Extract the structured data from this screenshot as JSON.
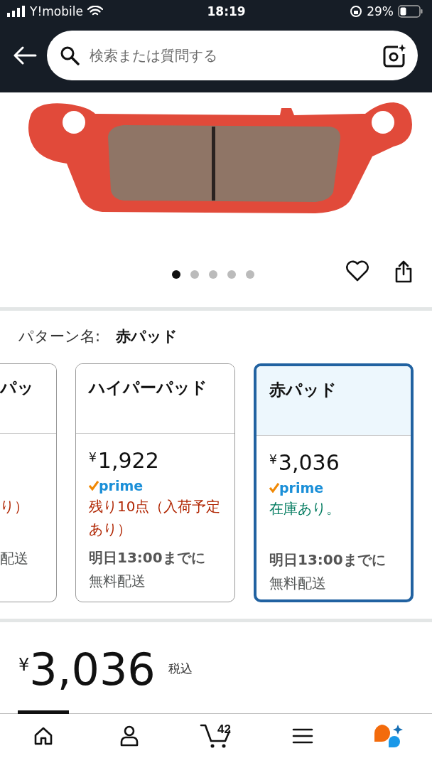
{
  "status_bar": {
    "carrier": "Y!mobile",
    "time": "18:19",
    "battery": "29%"
  },
  "search": {
    "placeholder": "検索または質問する"
  },
  "gallery": {
    "dots": [
      {
        "selected": true
      },
      {
        "selected": false
      },
      {
        "selected": false
      },
      {
        "selected": false
      },
      {
        "selected": false
      }
    ]
  },
  "pattern": {
    "label": "パターン名:",
    "value": "赤パッド"
  },
  "options": [
    {
      "name": "パッ",
      "stock": "り）",
      "in_stock": false,
      "delivery": "配送",
      "selected": false
    },
    {
      "name": "ハイパーパッド",
      "currency": "¥",
      "price": "1,922",
      "prime": "prime",
      "stock": "残り10点（入荷予定あり）",
      "in_stock": false,
      "delivery_bold": "明日13:00までに",
      "delivery": "無料配送",
      "selected": false
    },
    {
      "name": "赤パッド",
      "currency": "¥",
      "price": "3,036",
      "prime": "prime",
      "stock": "在庫あり。",
      "in_stock": true,
      "delivery_bold": "明日13:00までに",
      "delivery": "無料配送",
      "selected": true
    }
  ],
  "price": {
    "currency": "¥",
    "amount": "3,036",
    "tax": "税込"
  },
  "nav": [
    {
      "kind": "home",
      "selected": true
    },
    {
      "kind": "account",
      "selected": false
    },
    {
      "kind": "cart",
      "badge": "42",
      "selected": false
    },
    {
      "kind": "menu",
      "selected": false
    },
    {
      "kind": "assistant",
      "selected": false
    }
  ]
}
